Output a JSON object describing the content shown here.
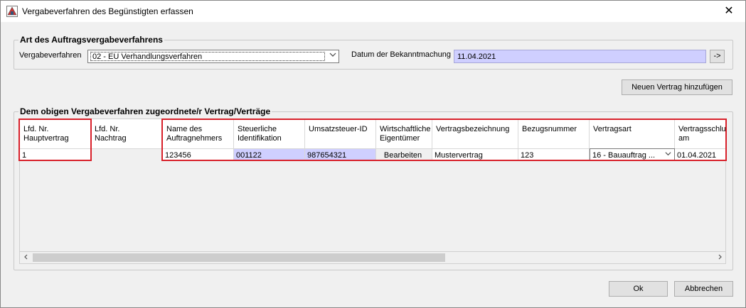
{
  "window": {
    "title": "Vergabeverfahren des Begünstigten erfassen",
    "close_glyph": "✕"
  },
  "procedure_group": {
    "legend": "Art des Auftragsvergabeverfahrens",
    "procedure_label": "Vergabeverfahren",
    "procedure_value": "02 - EU Verhandlungsverfahren",
    "date_label": "Datum der Bekanntmachung",
    "date_value": "11.04.2021",
    "arrow_button": "->"
  },
  "add_contract_button": "Neuen Vertrag hinzufügen",
  "contracts_group": {
    "legend": "Dem obigen Vergabeverfahren zugeordnete/r Vertrag/Verträge",
    "columns": [
      {
        "line1": "Lfd. Nr.",
        "line2": "Hauptvertrag"
      },
      {
        "line1": "Lfd. Nr.",
        "line2": "Nachtrag"
      },
      {
        "line1": "Name des",
        "line2": "Auftragnehmers"
      },
      {
        "line1": "Steuerliche",
        "line2": "Identifikation"
      },
      {
        "line1": "Umsatzsteuer-ID",
        "line2": ""
      },
      {
        "line1": "Wirtschaftliche",
        "line2": "Eigentümer"
      },
      {
        "line1": "Vertragsbezeichnung",
        "line2": ""
      },
      {
        "line1": "Bezugsnummer",
        "line2": ""
      },
      {
        "line1": "Vertragsart",
        "line2": ""
      },
      {
        "line1": "Vertragsschlu",
        "line2": "am"
      }
    ],
    "row": {
      "hauptvertrag": "1",
      "nachtrag": "",
      "auftragnehmer": "123456",
      "steuer_id": "001122",
      "ust_id": "987654321",
      "eigentuemer_button": "Bearbeiten",
      "bezeichnung": "Mustervertrag",
      "bezugsnummer": "123",
      "vertragsart": "16 - Bauauftrag ...",
      "vertragsschluss": "01.04.2021"
    }
  },
  "buttons": {
    "ok": "Ok",
    "cancel": "Abbrechen"
  },
  "colors": {
    "readonly_field": "#cfcfff",
    "highlight_box": "#d8202a"
  }
}
